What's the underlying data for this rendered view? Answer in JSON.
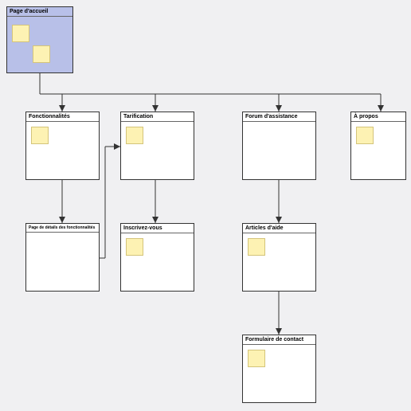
{
  "nodes": {
    "home": {
      "label": "Page d'accueil"
    },
    "features": {
      "label": "Fonctionnalités"
    },
    "pricing": {
      "label": "Tarification"
    },
    "forum": {
      "label": "Forum d'assistance"
    },
    "about": {
      "label": "À propos"
    },
    "detail": {
      "label": "Page de détails des fonctionnalités"
    },
    "signup": {
      "label": "Inscrivez-vous"
    },
    "articles": {
      "label": "Articles d'aide"
    },
    "contact": {
      "label": "Formulaire de contact"
    }
  }
}
